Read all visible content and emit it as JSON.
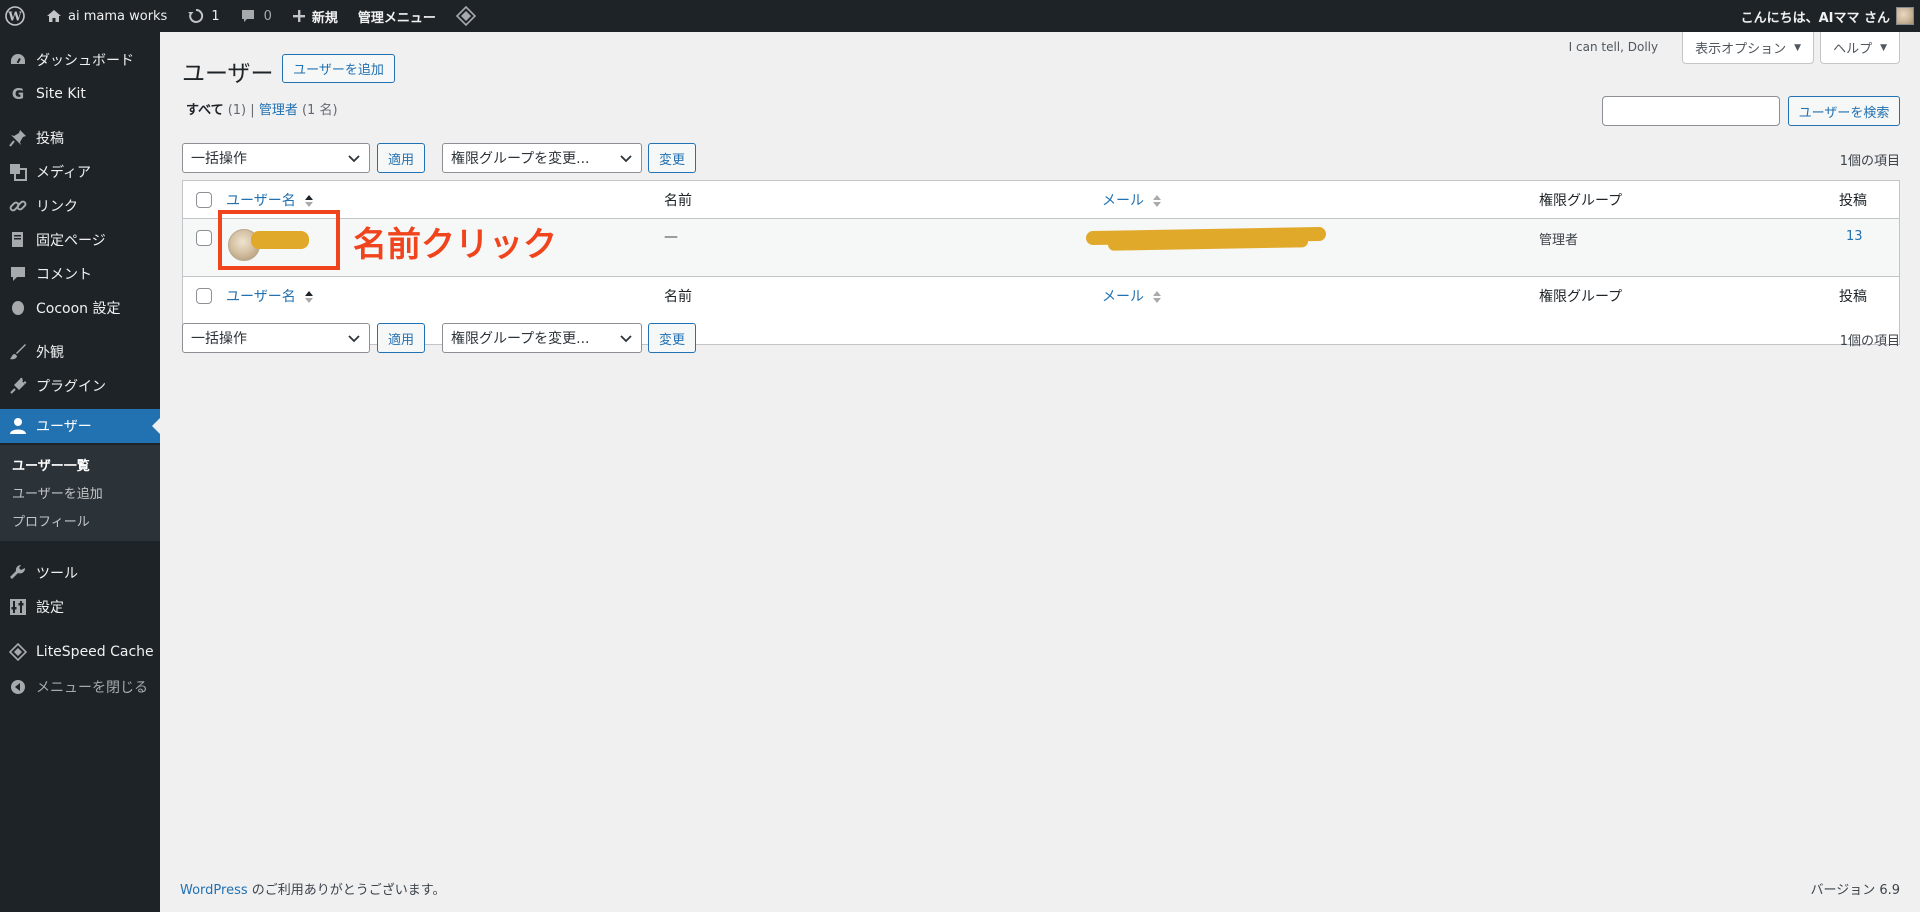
{
  "adminbar": {
    "site_name": "ai mama works",
    "updates_count": "1",
    "comments_count": "0",
    "new_label": "新規",
    "admin_menu_label": "管理メニュー",
    "greeting": "こんにちは、AIママ さん"
  },
  "sidebar": {
    "items": [
      {
        "label": "ダッシュボード",
        "icon": "dashboard-icon"
      },
      {
        "label": "Site Kit",
        "icon": "google-icon"
      },
      {
        "label": "投稿",
        "icon": "pin-icon"
      },
      {
        "label": "メディア",
        "icon": "media-icon"
      },
      {
        "label": "リンク",
        "icon": "link-icon"
      },
      {
        "label": "固定ページ",
        "icon": "page-icon"
      },
      {
        "label": "コメント",
        "icon": "comment-icon"
      },
      {
        "label": "Cocoon 設定",
        "icon": "cocoon-icon"
      },
      {
        "label": "外観",
        "icon": "brush-icon"
      },
      {
        "label": "プラグイン",
        "icon": "plugin-icon"
      },
      {
        "label": "ユーザー",
        "icon": "user-icon"
      },
      {
        "label": "ツール",
        "icon": "wrench-icon"
      },
      {
        "label": "設定",
        "icon": "settings-icon"
      },
      {
        "label": "LiteSpeed Cache",
        "icon": "litespeed-icon"
      },
      {
        "label": "メニューを閉じる",
        "icon": "collapse-icon"
      }
    ],
    "submenu": [
      "ユーザー一覧",
      "ユーザーを追加",
      "プロフィール"
    ]
  },
  "screen_meta": {
    "dolly": "I can tell, Dolly",
    "display_options": "表示オプション",
    "help": "ヘルプ"
  },
  "page": {
    "title": "ユーザー",
    "add_new": "ユーザーを追加",
    "filter_all": "すべて",
    "filter_all_count": "(1)",
    "filter_sep": "|",
    "filter_admin": "管理者",
    "filter_admin_count": "(1 名)",
    "search_button": "ユーザーを検索",
    "bulk_action": "一括操作",
    "apply": "適用",
    "role_change": "権限グループを変更...",
    "change": "変更",
    "items_count": "1個の項目"
  },
  "table": {
    "columns": [
      "ユーザー名",
      "名前",
      "メール",
      "権限グループ",
      "投稿"
    ],
    "rows": [
      {
        "username": "",
        "name": "—",
        "email": "",
        "role": "管理者",
        "posts": "13"
      }
    ]
  },
  "annotation": {
    "text": "名前クリック"
  },
  "footer": {
    "wp_link": "WordPress",
    "thanks": " のご利用ありがとうございます。",
    "version": "バージョン 6.9"
  },
  "colors": {
    "accent": "#2271b1",
    "annotation": "#f0441d",
    "redaction": "#e1a92a"
  }
}
